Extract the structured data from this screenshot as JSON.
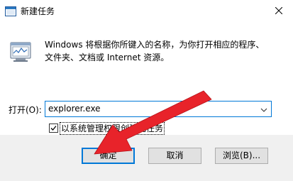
{
  "window": {
    "title": "新建任务"
  },
  "description": {
    "line1": "Windows 将根据你所键入的名称，为你打开相应的程序、",
    "line2": "文件夹、文档或 Internet 资源。"
  },
  "open_field": {
    "label": "打开(O):",
    "value": "explorer.exe"
  },
  "admin_checkbox": {
    "label": "以系统管理权限创建此任务",
    "checked": true
  },
  "buttons": {
    "ok": "确定",
    "cancel": "取消",
    "browse": "浏览(B)..."
  },
  "colors": {
    "accent": "#0078d7",
    "annotation_arrow": "#e8232a",
    "footer_bg": "#f0f0f0"
  },
  "icons": {
    "title": "run-dialog-icon",
    "content": "run-program-icon",
    "close": "close-icon",
    "combo": "chevron-down-icon",
    "checkbox": "checkmark-icon",
    "annotation": "red-arrow-annotation"
  }
}
